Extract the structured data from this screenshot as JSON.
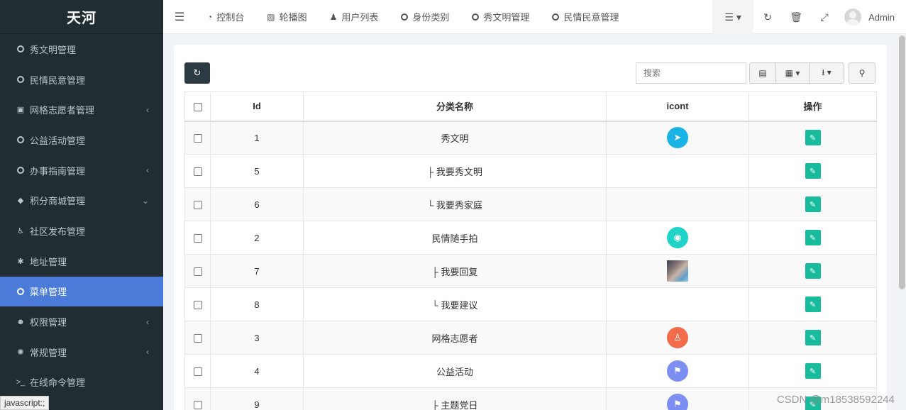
{
  "sidebar": {
    "logo": "天河",
    "items": [
      {
        "label": "秀文明管理",
        "icon": "circle-o-icon",
        "chevron": ""
      },
      {
        "label": "民情民意管理",
        "icon": "circle-o-icon",
        "chevron": ""
      },
      {
        "label": "网格志愿者管理",
        "icon": "id-badge-icon",
        "chevron": "‹"
      },
      {
        "label": "公益活动管理",
        "icon": "circle-o-icon",
        "chevron": ""
      },
      {
        "label": "办事指南管理",
        "icon": "circle-o-icon",
        "chevron": "‹"
      },
      {
        "label": "积分商城管理",
        "icon": "shopping-bag-icon",
        "chevron": "⌄"
      },
      {
        "label": "社区发布管理",
        "icon": "wheelchair-icon",
        "chevron": ""
      },
      {
        "label": "地址管理",
        "icon": "bug-icon",
        "chevron": ""
      },
      {
        "label": "菜单管理",
        "icon": "circle-o-icon",
        "chevron": ""
      },
      {
        "label": "权限管理",
        "icon": "users-icon",
        "chevron": "‹"
      },
      {
        "label": "常规管理",
        "icon": "cogs-icon",
        "chevron": "‹"
      },
      {
        "label": "在线命令管理",
        "icon": "terminal-icon",
        "chevron": ""
      }
    ],
    "active_label": "菜单管理",
    "status_tip": "javascript:;"
  },
  "topnav": {
    "links": [
      {
        "label": "控制台",
        "icon": "dashboard-icon"
      },
      {
        "label": "轮播图",
        "icon": "image-icon"
      },
      {
        "label": "用户列表",
        "icon": "user-icon"
      },
      {
        "label": "身份类别",
        "icon": "circle-o-icon"
      },
      {
        "label": "秀文明管理",
        "icon": "circle-o-icon"
      },
      {
        "label": "民情民意管理",
        "icon": "circle-o-icon"
      }
    ],
    "user": "Admin"
  },
  "toolbar": {
    "search_placeholder": "搜索"
  },
  "table": {
    "headers": [
      "Id",
      "分类名称",
      "icont",
      "操作"
    ],
    "rows": [
      {
        "id": "1",
        "name": "秀文明",
        "icon": "paper-plane-icon",
        "icon_color": "#1ab3e6"
      },
      {
        "id": "5",
        "name": "├ 我要秀文明",
        "icon": "",
        "icon_color": ""
      },
      {
        "id": "6",
        "name": "└ 我要秀家庭",
        "icon": "",
        "icon_color": ""
      },
      {
        "id": "2",
        "name": "民情随手拍",
        "icon": "camera-icon",
        "icon_color": "#1fd3c6"
      },
      {
        "id": "7",
        "name": "├ 我要回复",
        "icon": "photo-thumbnail",
        "icon_color": ""
      },
      {
        "id": "8",
        "name": "└ 我要建议",
        "icon": "",
        "icon_color": ""
      },
      {
        "id": "3",
        "name": "网格志愿者",
        "icon": "volunteer-icon",
        "icon_color": "#f26b4b"
      },
      {
        "id": "4",
        "name": "公益活动",
        "icon": "flag-icon",
        "icon_color": "#7c8ef2"
      },
      {
        "id": "9",
        "name": "├ 主题党日",
        "icon": "flag-icon",
        "icon_color": "#7c8ef2"
      }
    ]
  },
  "watermark": "CSDN @m18538592244",
  "colors": {
    "sidebar_bg": "#222d32",
    "active_item": "#4a7bd8",
    "edit_button": "#18bc9c",
    "refresh_button": "#2c3b41"
  }
}
